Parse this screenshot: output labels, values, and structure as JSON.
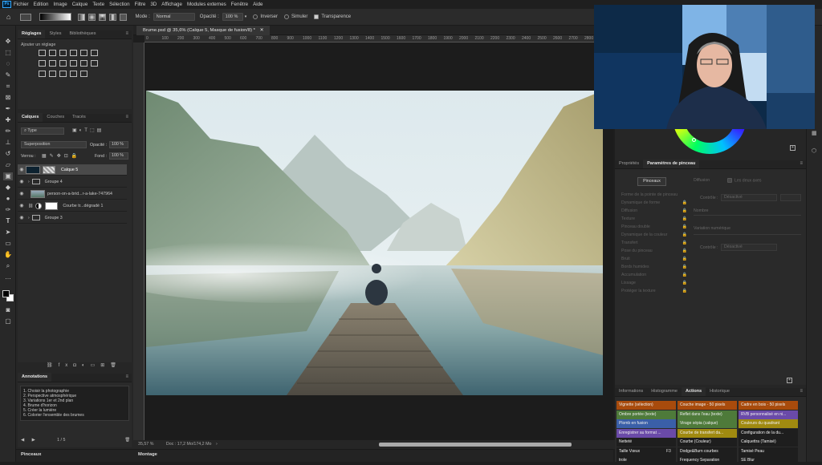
{
  "menubar": {
    "logo": "Ps",
    "items": [
      "Fichier",
      "Edition",
      "Image",
      "Calque",
      "Texte",
      "Sélection",
      "Filtre",
      "3D",
      "Affichage",
      "Modules externes",
      "Fenêtre",
      "Aide"
    ]
  },
  "options": {
    "mode_label": "Mode :",
    "mode_value": "Normal",
    "opacity_label": "Opacité :",
    "opacity_value": "100 %",
    "invert_label": "Inverser",
    "simulate_label": "Simuler",
    "transparency_label": "Transparence"
  },
  "left_panel": {
    "tabs": [
      "Réglages",
      "Styles",
      "Bibliothèques"
    ],
    "add_adjustment": "Ajouter un réglage",
    "layers_tabs": [
      "Calques",
      "Couches",
      "Tracés"
    ],
    "filter_kind": "Type",
    "blend_mode": "Superposition",
    "opacity_label": "Opacité :",
    "opacity_value": "100 %",
    "lock_label": "Verrou :",
    "fill_label": "Fond :",
    "fill_value": "100 %",
    "layers": [
      {
        "name": "Calque 5",
        "selected": true
      },
      {
        "name": "Groupe 4",
        "selected": false
      },
      {
        "name": "person-on-a-brid...r-a-lake-747964",
        "selected": false
      },
      {
        "name": "Courbe tr...dégradé 1",
        "selected": false
      },
      {
        "name": "Groupe 3",
        "selected": false
      }
    ],
    "annotations_title": "Annotations",
    "annotations": [
      "1. Choisir la photographie",
      "2. Perspective atmosphérique",
      "3. Variations 1er et 2nd plan",
      "4. Brume d'horizon",
      "5. Créer la lumière",
      "6. Colorier l'ensemble des brumes"
    ],
    "annotation_pager": "1 / 5",
    "brushes_tab": "Pinceaux"
  },
  "document": {
    "tab_title": "Brume.psd @ 35,6% (Calque 5, Masque de fusion/8) *",
    "ruler_ticks": [
      "0",
      "100",
      "200",
      "300",
      "400",
      "500",
      "600",
      "700",
      "800",
      "900",
      "1000",
      "1100",
      "1200",
      "1300",
      "1400",
      "1500",
      "1600",
      "1700",
      "1800",
      "1900",
      "2000",
      "2100",
      "2200",
      "2300",
      "2400",
      "2500",
      "2600",
      "2700",
      "2800",
      "2900"
    ],
    "zoom": "35,57 %",
    "doc_info": "Doc : 17,2 Mo/174,2 Mo",
    "bottom_tab": "Montage"
  },
  "properties": {
    "tabs": [
      "Propriétés",
      "Paramètres de pinceau"
    ],
    "brush_button": "Pinceaux",
    "items": [
      "Forme de la pointe de pinceau",
      "Dynamique de forme",
      "Diffusion",
      "Texture",
      "Pinceau double",
      "Dynamique de la couleur",
      "Transfert",
      "Pose du pinceau",
      "Bruit",
      "Bords humides",
      "Accumulation",
      "Lissage",
      "Protéger la texture"
    ],
    "diffusion_label": "Diffusion",
    "both_axes": "Les deux axes",
    "control_label": "Contrôle :",
    "control_value": "Désactivé",
    "count_label": "Nombre",
    "variation_label": "Variation numérique",
    "control2_value": "Désactivé"
  },
  "actions": {
    "tabs": [
      "Informations",
      "Histogramme",
      "Actions",
      "Historique"
    ],
    "rows": [
      [
        {
          "label": "Vignette (sélection)",
          "color": "#a84b0c"
        },
        {
          "label": "Couche image - 50 pixels",
          "color": "#a84b0c"
        },
        {
          "label": "Cadre en bois - 50 pixels",
          "color": "#a84b0c"
        }
      ],
      [
        {
          "label": "Ombre portée (texte)",
          "color": "#4e7a3a"
        },
        {
          "label": "Reflet dans l'eau (texte)",
          "color": "#4e7a3a"
        },
        {
          "label": "RVB personnalisé en ni...",
          "color": "#6a4aa8"
        }
      ],
      [
        {
          "label": "Plomb en fusion",
          "color": "#3a5fa8"
        },
        {
          "label": "Virage sépia (calque)",
          "color": "#4e7a3a"
        },
        {
          "label": "Couleurs du quadrant",
          "color": "#a08a10"
        }
      ],
      [
        {
          "label": "Enregistrer au format ...",
          "color": "#6a4aa8"
        },
        {
          "label": "Courbe de transfert da...",
          "color": "#a08a10"
        },
        {
          "label": "Configuration de la du...",
          "color": "#1e1e1e"
        }
      ],
      [
        {
          "label": "Netteté",
          "color": "#1e1e1e"
        },
        {
          "label": "Courbe (Couleur)",
          "color": "#1e1e1e"
        },
        {
          "label": "Calquettra (Tamisé)",
          "color": "#1e1e1e"
        }
      ],
      [
        {
          "label": "Taille Vœux",
          "color": "#1e1e1e"
        },
        {
          "label": "Dodge&Burn courbes",
          "color": "#1e1e1e"
        },
        {
          "label": "Tamisé Peau",
          "color": "#1e1e1e"
        }
      ],
      [
        {
          "label": "trole",
          "color": "#1e1e1e"
        },
        {
          "label": "Frequency Separation",
          "color": "#1e1e1e"
        },
        {
          "label": "SE Blur",
          "color": "#1e1e1e"
        }
      ]
    ],
    "f_key": "F3"
  }
}
